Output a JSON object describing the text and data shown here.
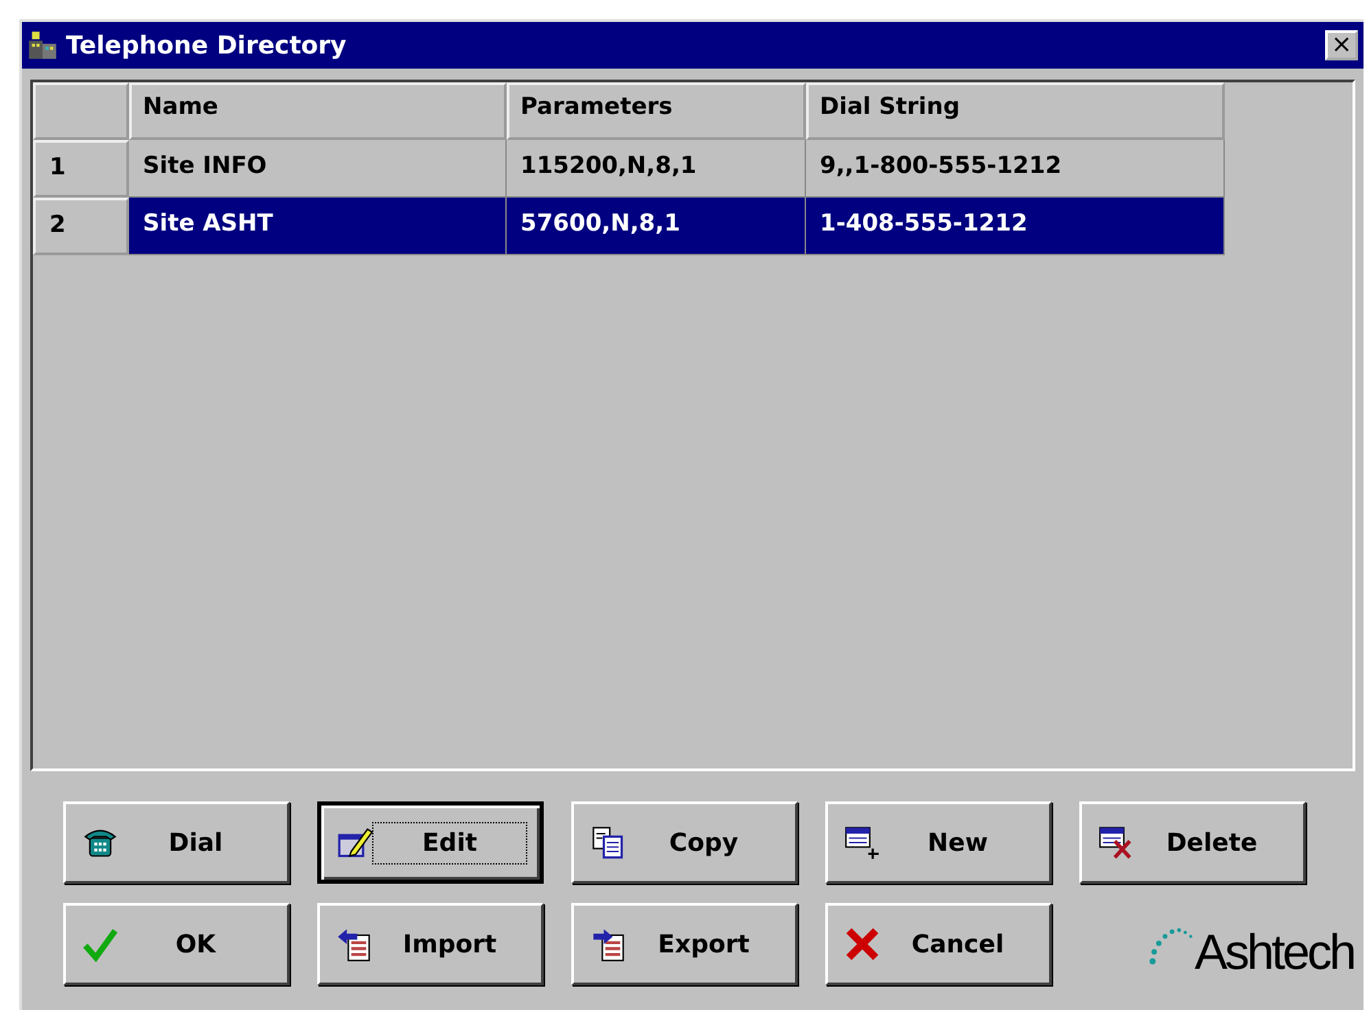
{
  "window": {
    "title": "Telephone Directory",
    "close": "×"
  },
  "table": {
    "columns": [
      "Name",
      "Parameters",
      "Dial String"
    ],
    "rows": [
      {
        "index": "1",
        "cells": [
          "Site INFO",
          "115200,N,8,1",
          "9,,1-800-555-1212"
        ],
        "selected": false
      },
      {
        "index": "2",
        "cells": [
          "Site ASHT",
          "57600,N,8,1",
          "1-408-555-1212"
        ],
        "selected": true
      }
    ]
  },
  "buttons": [
    [
      {
        "label": "Dial",
        "kind": "phone",
        "focused": false
      },
      {
        "label": "Edit",
        "kind": "edit",
        "focused": true
      },
      {
        "label": "Copy",
        "kind": "copy",
        "focused": false
      },
      {
        "label": "New",
        "kind": "new",
        "focused": false
      },
      {
        "label": "Delete",
        "kind": "delete",
        "focused": false
      }
    ],
    [
      {
        "label": "OK",
        "kind": "check",
        "focused": false
      },
      {
        "label": "Import",
        "kind": "import",
        "focused": false
      },
      {
        "label": "Export",
        "kind": "export",
        "focused": false
      },
      {
        "label": "Cancel",
        "kind": "cancel",
        "focused": false
      }
    ]
  ],
  "logo": "Ashtech"
}
